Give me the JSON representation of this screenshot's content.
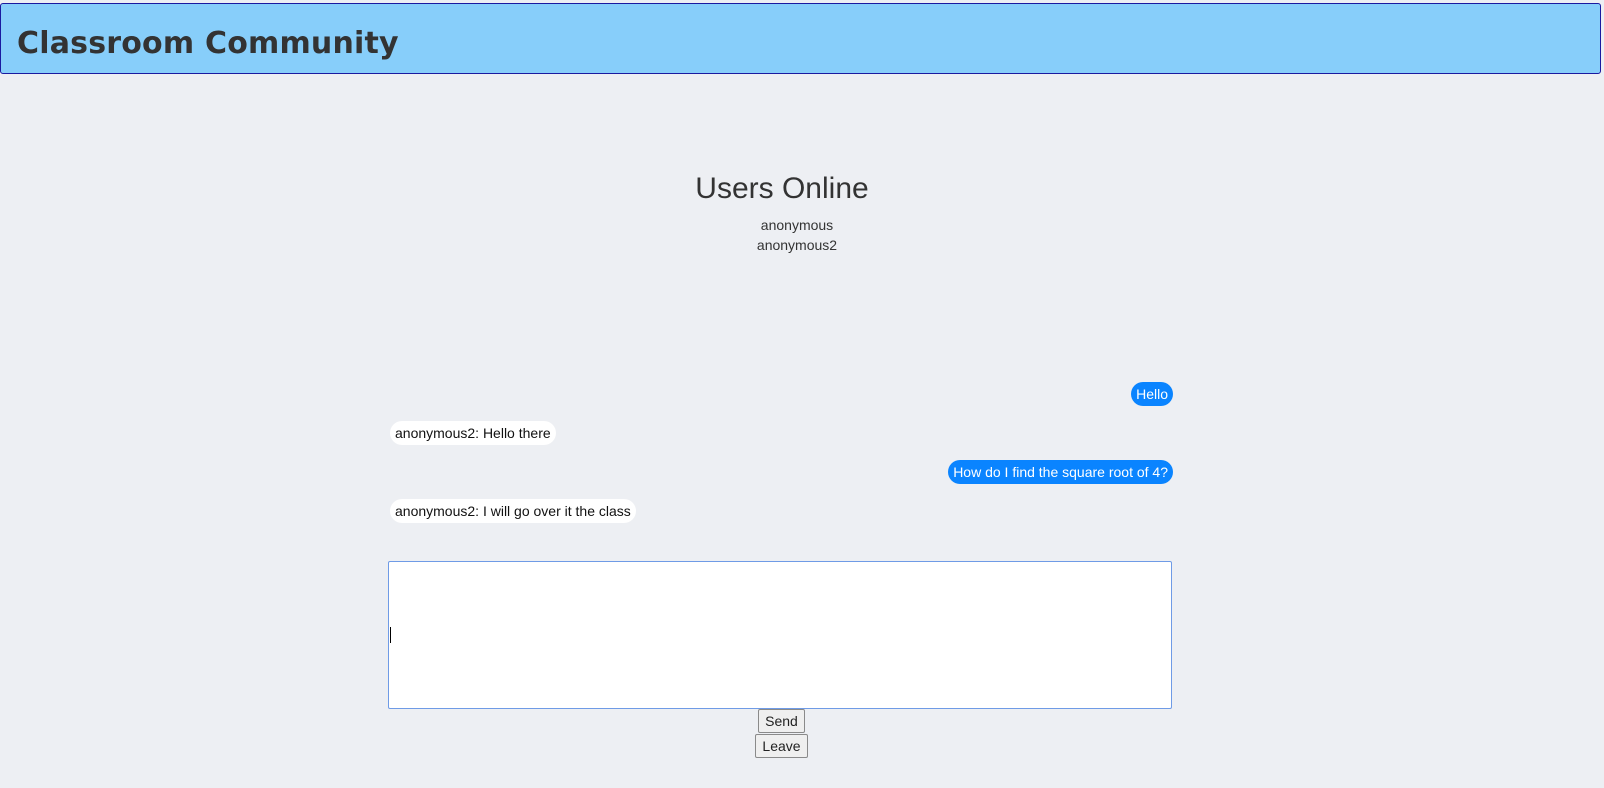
{
  "header": {
    "title": "Classroom Community"
  },
  "users_online": {
    "title": "Users Online",
    "users": [
      "anonymous",
      "anonymous2"
    ]
  },
  "messages": [
    {
      "direction": "sent",
      "text": "Hello"
    },
    {
      "direction": "received",
      "text": "anonymous2: Hello there"
    },
    {
      "direction": "sent",
      "text": "How do I find the square root of 4?"
    },
    {
      "direction": "received",
      "text": "anonymous2: I will go over it the class"
    }
  ],
  "composer": {
    "value": "",
    "placeholder": ""
  },
  "buttons": {
    "send_label": "Send",
    "leave_label": "Leave"
  },
  "colors": {
    "header_bg": "#87cefa",
    "page_bg": "#edeff3",
    "sent_bubble": "#0a84ff",
    "received_bubble": "#ffffff"
  }
}
